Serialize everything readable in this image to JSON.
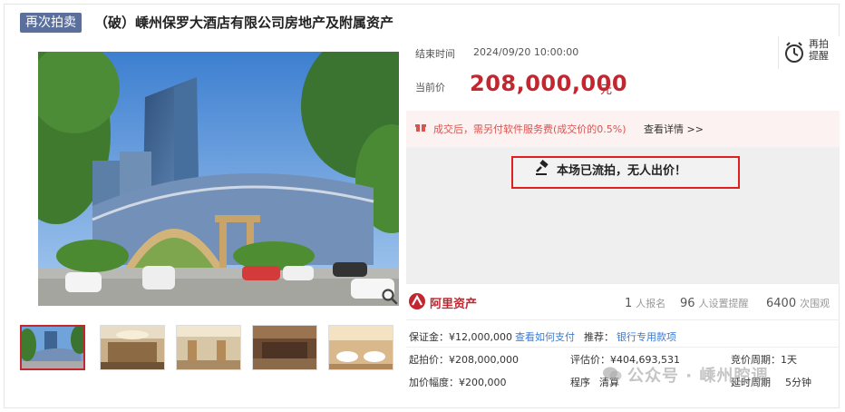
{
  "header": {
    "badge": "再次拍卖",
    "title": "（破）嵊州保罗大酒店有限公司房地产及附属资产"
  },
  "auction": {
    "end_label": "结束时间",
    "end_time": "2024/09/20 10:00:00",
    "current_label": "当前价",
    "current_price": "208,000,000",
    "currency_unit": "元",
    "remind_label_1": "再拍",
    "remind_label_2": "提醒"
  },
  "fee": {
    "text": "成交后，需另付软件服务费(成交价的0.5%)",
    "link": "查看详情 >>"
  },
  "status": {
    "text": "本场已流拍，无人出价！"
  },
  "platform": {
    "name": "阿里资产",
    "stats": [
      {
        "num": "1",
        "unit": "人报名"
      },
      {
        "num": "96",
        "unit": "人设置提醒"
      },
      {
        "num": "6400",
        "unit": "次围观"
      }
    ]
  },
  "details": {
    "deposit_label": "保证金：¥12,000,000",
    "deposit_link": "查看如何支付",
    "recommend_label": "推荐：",
    "recommend_link": "银行专用款项",
    "start_price": "起拍价：¥208,000,000",
    "eval_price": "评估价：¥404,693,531",
    "bid_cycle": "竞价周期：1天",
    "increment": "加价幅度：¥200,000",
    "procedure": "程序",
    "procedure_val": "清算",
    "delay": "延时周期",
    "delay_val": "5分钟"
  },
  "watermark": {
    "text": "公众号 · 嵊州腔调"
  },
  "colors": {
    "accent_red": "#c3262f",
    "badge_blue": "#5a6f9c",
    "link_blue": "#3a7bd5",
    "highlight_border": "#e02020"
  }
}
